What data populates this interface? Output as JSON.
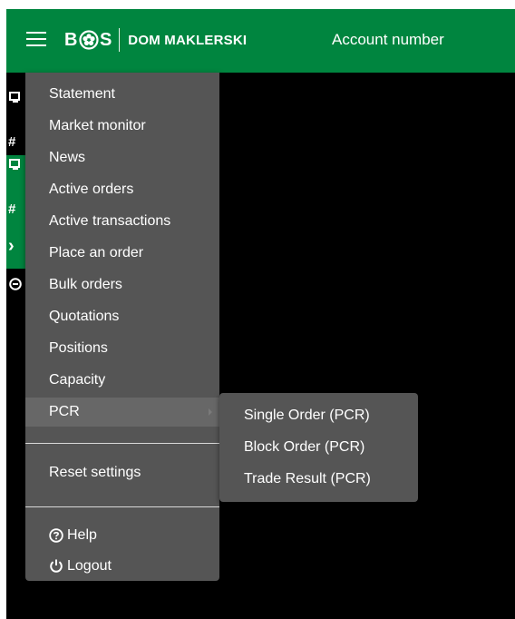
{
  "header": {
    "logo_left": "B",
    "logo_right": "S",
    "brand": "DOM MAKLERSKI",
    "account_label": "Account number"
  },
  "background_strip": {
    "hash_1": "#",
    "hash_2": "#",
    "chevron": "›"
  },
  "menu": {
    "items": [
      {
        "label": "Statement"
      },
      {
        "label": "Market monitor"
      },
      {
        "label": "News"
      },
      {
        "label": "Active orders"
      },
      {
        "label": "Active transactions"
      },
      {
        "label": "Place an order"
      },
      {
        "label": "Bulk orders"
      },
      {
        "label": "Quotations"
      },
      {
        "label": "Positions"
      },
      {
        "label": "Capacity"
      },
      {
        "label": "PCR"
      }
    ],
    "reset_label": "Reset settings",
    "help_label": "Help",
    "logout_label": "Logout"
  },
  "submenu": {
    "items": [
      {
        "label": "Single Order (PCR)"
      },
      {
        "label": "Block Order (PCR)"
      },
      {
        "label": "Trade Result (PCR)"
      }
    ]
  },
  "colors": {
    "brand_green": "#00853f",
    "menu_bg": "#555555",
    "menu_active": "#676767",
    "app_bg": "#000000"
  }
}
